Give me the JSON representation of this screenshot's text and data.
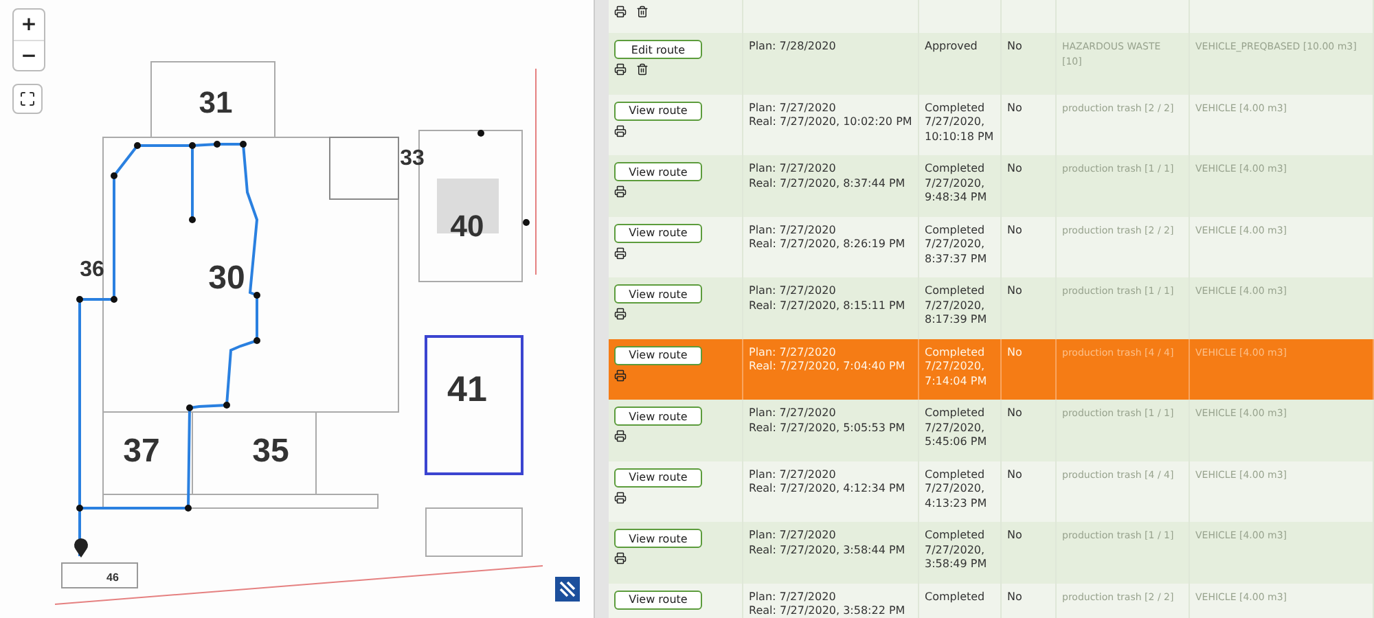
{
  "map": {
    "zoom_in": "+",
    "zoom_out": "−",
    "buildings": [
      {
        "label": "31"
      },
      {
        "label": "33"
      },
      {
        "label": "40"
      },
      {
        "label": "36"
      },
      {
        "label": "30"
      },
      {
        "label": "41"
      },
      {
        "label": "37"
      },
      {
        "label": "35"
      },
      {
        "label": "46"
      }
    ]
  },
  "table": {
    "rows": [
      {
        "kind": "stub",
        "deletable": true,
        "selected": false
      },
      {
        "kind": "edit",
        "button": "Edit route",
        "plan": "Plan: 7/28/2020",
        "status": [
          "Approved"
        ],
        "flag": "No",
        "waste": "HAZARDOUS WASTE [10]",
        "vehicle": "VEHICLE_PREQBASED [10.00 m3]",
        "deletable": true,
        "selected": false
      },
      {
        "kind": "view",
        "button": "View route",
        "plan": "Plan: 7/27/2020",
        "real": "Real: 7/27/2020, 10:02:20 PM",
        "status": [
          "Completed",
          "7/27/2020,",
          "10:10:18 PM"
        ],
        "flag": "No",
        "waste": "production trash [2 / 2]",
        "vehicle": "VEHICLE [4.00 m3]",
        "deletable": false,
        "selected": false
      },
      {
        "kind": "view",
        "button": "View route",
        "plan": "Plan: 7/27/2020",
        "real": "Real: 7/27/2020, 8:37:44 PM",
        "status": [
          "Completed",
          "7/27/2020,",
          "9:48:34 PM"
        ],
        "flag": "No",
        "waste": "production trash [1 / 1]",
        "vehicle": "VEHICLE [4.00 m3]",
        "deletable": false,
        "selected": false
      },
      {
        "kind": "view",
        "button": "View route",
        "plan": "Plan: 7/27/2020",
        "real": "Real: 7/27/2020, 8:26:19 PM",
        "status": [
          "Completed",
          "7/27/2020,",
          "8:37:37 PM"
        ],
        "flag": "No",
        "waste": "production trash [2 / 2]",
        "vehicle": "VEHICLE [4.00 m3]",
        "deletable": false,
        "selected": false
      },
      {
        "kind": "view",
        "button": "View route",
        "plan": "Plan: 7/27/2020",
        "real": "Real: 7/27/2020, 8:15:11 PM",
        "status": [
          "Completed",
          "7/27/2020,",
          "8:17:39 PM"
        ],
        "flag": "No",
        "waste": "production trash [1 / 1]",
        "vehicle": "VEHICLE [4.00 m3]",
        "deletable": false,
        "selected": false
      },
      {
        "kind": "view",
        "button": "View route",
        "plan": "Plan: 7/27/2020",
        "real": "Real: 7/27/2020, 7:04:40 PM",
        "status": [
          "Completed",
          "7/27/2020,",
          "7:14:04 PM"
        ],
        "flag": "No",
        "waste": "production trash [4 / 4]",
        "vehicle": "VEHICLE [4.00 m3]",
        "deletable": false,
        "selected": true
      },
      {
        "kind": "view",
        "button": "View route",
        "plan": "Plan: 7/27/2020",
        "real": "Real: 7/27/2020, 5:05:53 PM",
        "status": [
          "Completed",
          "7/27/2020,",
          "5:45:06 PM"
        ],
        "flag": "No",
        "waste": "production trash [1 / 1]",
        "vehicle": "VEHICLE [4.00 m3]",
        "deletable": false,
        "selected": false
      },
      {
        "kind": "view",
        "button": "View route",
        "plan": "Plan: 7/27/2020",
        "real": "Real: 7/27/2020, 4:12:34 PM",
        "status": [
          "Completed",
          "7/27/2020,",
          "4:13:23 PM"
        ],
        "flag": "No",
        "waste": "production trash [4 / 4]",
        "vehicle": "VEHICLE [4.00 m3]",
        "deletable": false,
        "selected": false
      },
      {
        "kind": "view",
        "button": "View route",
        "plan": "Plan: 7/27/2020",
        "real": "Real: 7/27/2020, 3:58:44 PM",
        "status": [
          "Completed",
          "7/27/2020,",
          "3:58:49 PM"
        ],
        "flag": "No",
        "waste": "production trash [1 / 1]",
        "vehicle": "VEHICLE [4.00 m3]",
        "deletable": false,
        "selected": false
      },
      {
        "kind": "view",
        "button": "View route",
        "plan": "Plan: 7/27/2020",
        "real": "Real: 7/27/2020, 3:58:22 PM",
        "status": [
          "Completed"
        ],
        "flag": "No",
        "waste": "production trash [2 / 2]",
        "vehicle": "VEHICLE [4.00 m3]",
        "deletable": false,
        "selected": false
      }
    ]
  }
}
